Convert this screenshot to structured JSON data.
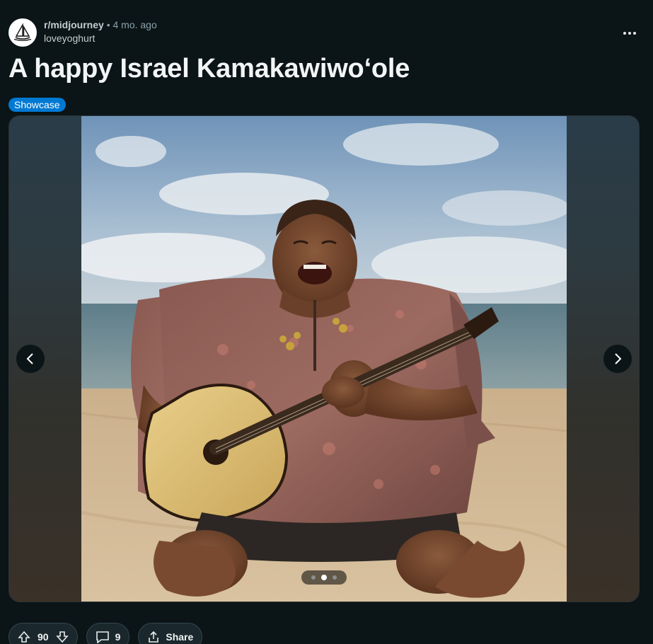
{
  "post": {
    "subreddit": "r/midjourney",
    "separator": "•",
    "age": "4 mo. ago",
    "author": "loveyoghurt",
    "title": "A happy Israel Kamakawiwoʻole",
    "flair": "Showcase"
  },
  "gallery": {
    "image_count": 3,
    "current_index": 2,
    "image_alt": "A happy Israel Kamakawiwoʻole"
  },
  "actions": {
    "votes": "90",
    "comments": "9",
    "share_label": "Share"
  },
  "icons": {
    "avatar": "sailboat-icon",
    "more": "more-horizontal-icon",
    "prev": "chevron-left-icon",
    "next": "chevron-right-icon",
    "upvote": "arrow-up-icon",
    "downvote": "arrow-down-icon",
    "comment": "comment-icon",
    "share": "share-icon"
  },
  "colors": {
    "background": "#0b1416",
    "flair": "#0079d3",
    "title": "#f2f4f5"
  }
}
